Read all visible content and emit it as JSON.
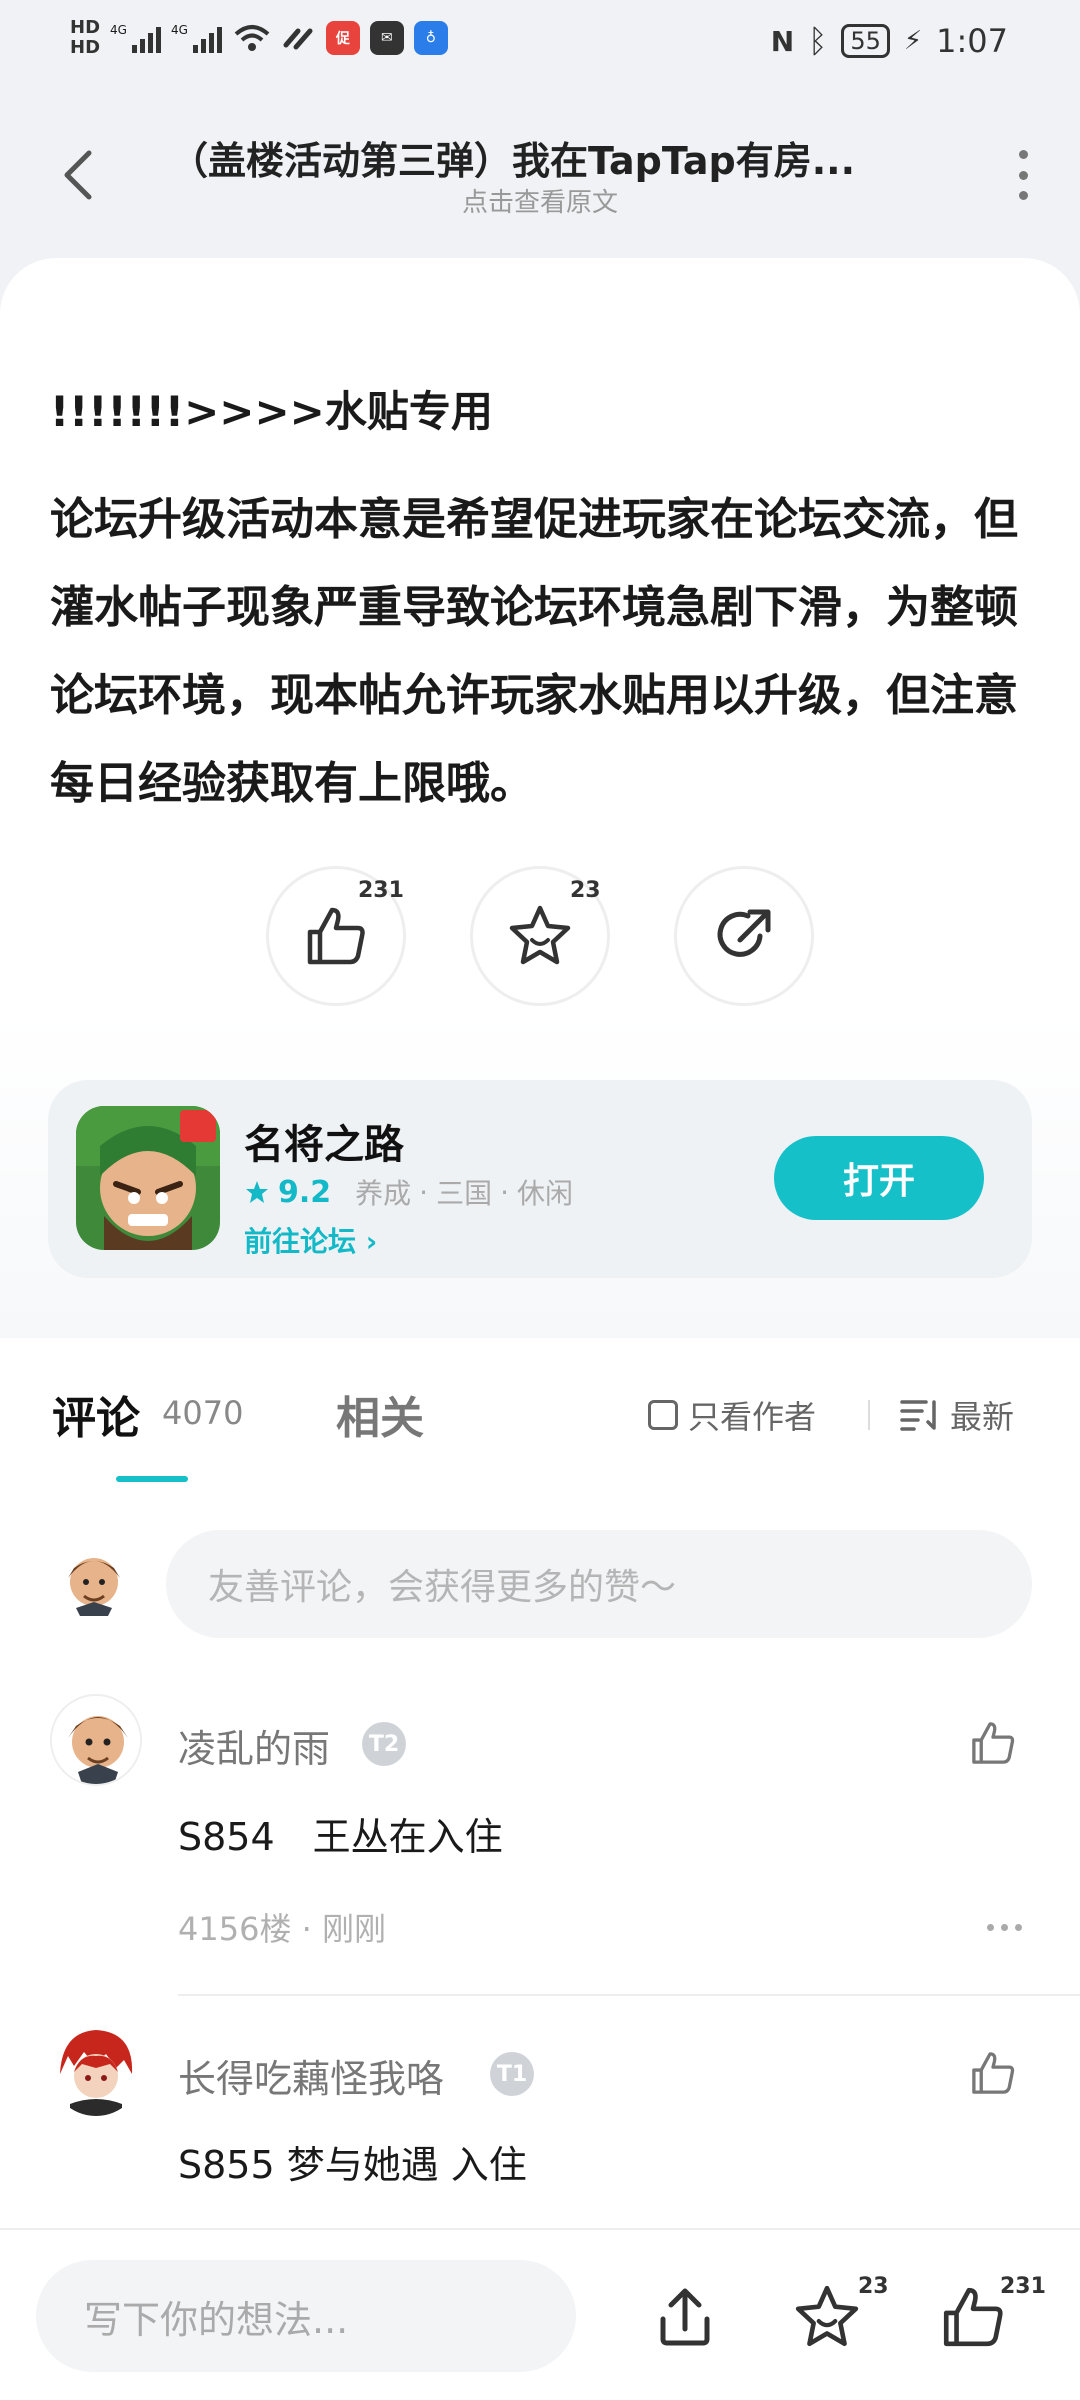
{
  "status_bar": {
    "hd1": "HD",
    "hd2": "HD",
    "net1": "4G",
    "net2": "4G",
    "battery": "55",
    "time": "1:07",
    "icons": [
      "signal-icon",
      "wifi-icon",
      "link-icon",
      "app-red-icon",
      "mail-icon",
      "bulb-icon",
      "nfc-icon",
      "bluetooth-icon",
      "charging-icon"
    ]
  },
  "header": {
    "title": "（盖楼活动第三弹）我在TapTap有房...",
    "subtitle": "点击查看原文"
  },
  "post": {
    "heading": "!!!!!!!>>>>水贴专用",
    "body": "论坛升级活动本意是希望促进玩家在论坛交流，但灌水帖子现象严重导致论坛环境急剧下滑，为整顿论坛环境，现本帖允许玩家水贴用以升级，但注意每日经验获取有上限哦。",
    "like_count": "231",
    "favorite_count": "23"
  },
  "game": {
    "name": "名将之路",
    "rating": "9.2",
    "tags": [
      "养成",
      "三国",
      "休闲"
    ],
    "forum_link": "前往论坛",
    "open_label": "打开",
    "accent": "#16c0c8"
  },
  "comments_section": {
    "tab_comments": "评论",
    "comment_count": "4070",
    "tab_related": "相关",
    "author_only": "只看作者",
    "sort_label": "最新",
    "input_placeholder": "友善评论，会获得更多的赞～"
  },
  "comments": [
    {
      "name": "凌乱的雨",
      "badge": "T2",
      "text": "S854　王丛在入住",
      "meta": "4156楼 · 刚刚"
    },
    {
      "name": "长得吃藕怪我咯",
      "badge": "T1",
      "text": "S855 梦与她遇 入住"
    }
  ],
  "bottom_bar": {
    "input_placeholder": "写下你的想法...",
    "favorite_count": "23",
    "like_count": "231"
  }
}
